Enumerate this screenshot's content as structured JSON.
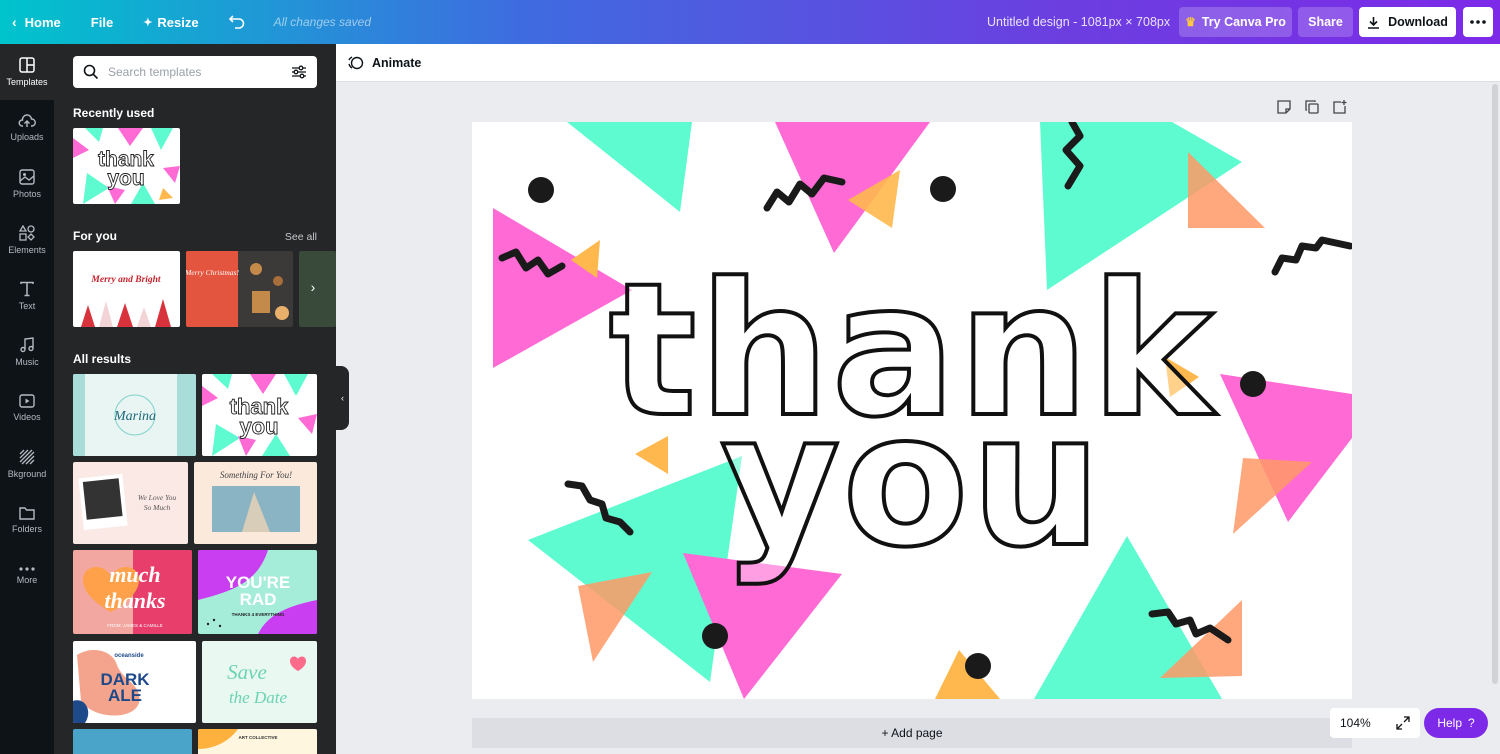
{
  "topbar": {
    "home": "Home",
    "file": "File",
    "resize": "Resize",
    "saved_status": "All changes saved",
    "doc_title": "Untitled design - 1081px × 708px",
    "try_pro": "Try Canva Pro",
    "share": "Share",
    "download": "Download"
  },
  "rail": {
    "items": [
      {
        "label": "Templates",
        "icon": "templates-icon"
      },
      {
        "label": "Uploads",
        "icon": "upload-icon"
      },
      {
        "label": "Photos",
        "icon": "photo-icon"
      },
      {
        "label": "Elements",
        "icon": "elements-icon"
      },
      {
        "label": "Text",
        "icon": "text-icon"
      },
      {
        "label": "Music",
        "icon": "music-icon"
      },
      {
        "label": "Videos",
        "icon": "video-icon"
      },
      {
        "label": "Bkground",
        "icon": "background-icon"
      },
      {
        "label": "Folders",
        "icon": "folder-icon"
      },
      {
        "label": "More",
        "icon": "more-icon"
      }
    ]
  },
  "panel": {
    "search_placeholder": "Search templates",
    "recently_used": "Recently used",
    "for_you": "For you",
    "see_all": "See all",
    "all_results": "All results",
    "templates": {
      "t_thank": [
        "thank",
        "you"
      ],
      "t_merry": "Merry and Bright",
      "t_merry_small": "Merry Christmas!",
      "t_marina": "Marina",
      "t_love": [
        "We Love You",
        "So Much"
      ],
      "t_something": "Something For You!",
      "t_much": [
        "much",
        "thanks"
      ],
      "t_much_footer": "FROM: JAMES & CAMILLE",
      "t_rad": [
        "YOU'RE",
        "RAD"
      ],
      "t_rad_small": "THANKS 4 EVERYTHING",
      "t_dark": [
        "DARK",
        "ALE"
      ],
      "t_dark_small": "oceanside",
      "t_save": [
        "Save",
        "the Date"
      ],
      "t_art": "ART COLLECTIVE"
    }
  },
  "canvas": {
    "animate": "Animate",
    "design_words": [
      "thank",
      "you"
    ],
    "add_page": "+ Add page",
    "zoom": "104%",
    "help": "Help",
    "help_icon": "?"
  }
}
